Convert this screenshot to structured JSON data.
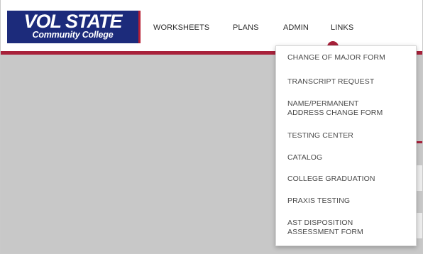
{
  "logo": {
    "line1": "VOL STATE",
    "line2": "Community College"
  },
  "nav": {
    "items": [
      {
        "label": "WORKSHEETS"
      },
      {
        "label": "PLANS"
      },
      {
        "label": "ADMIN"
      },
      {
        "label": "LINKS"
      }
    ],
    "active": "LINKS"
  },
  "dropdown": {
    "items": [
      {
        "label": "CHANGE OF MAJOR FORM"
      },
      {
        "label": "TRANSCRIPT REQUEST"
      },
      {
        "label_line1": "NAME/PERMANENT",
        "label_line2": "ADDRESS CHANGE FORM"
      },
      {
        "label": "TESTING CENTER"
      },
      {
        "label": "CATALOG"
      },
      {
        "label": "COLLEGE GRADUATION"
      },
      {
        "label": "PRAXIS TESTING"
      },
      {
        "label_line1": "AST DISPOSITION",
        "label_line2": "ASSESSMENT FORM"
      }
    ]
  },
  "colors": {
    "brand_navy": "#1c2b7b",
    "brand_red": "#a8213a",
    "overlay": "#c8c8c8"
  }
}
